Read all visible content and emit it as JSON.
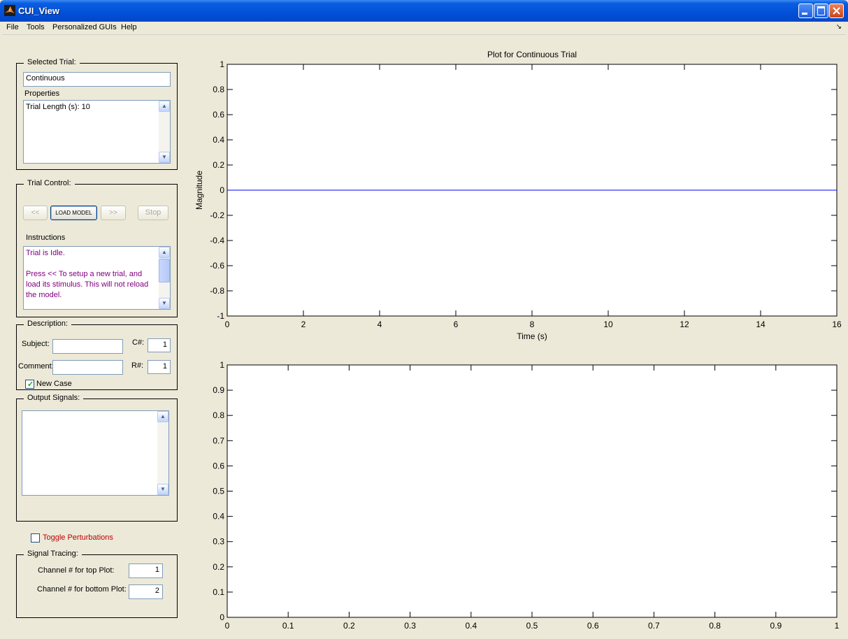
{
  "window": {
    "title": "CUI_View"
  },
  "menu": [
    "File",
    "Tools",
    "Personalized GUIs",
    "Help"
  ],
  "selected_trial": {
    "title": "Selected Trial:",
    "value": "Continuous",
    "properties_label": "Properties",
    "properties": "Trial Length (s): 10"
  },
  "trial_control": {
    "title": "Trial Control:",
    "prev_label": "<<",
    "load_label": "LOAD MODEL",
    "next_label": ">>",
    "stop_label": "Stop",
    "instructions_label": "Instructions",
    "instructions_line1": "Trial is Idle.",
    "instructions_line2": "Press  <<  To setup a new trial, and load its stimulus. This will not reload the model.",
    "instructions_color": "#800080"
  },
  "description": {
    "title": "Description:",
    "subject_label": "Subject:",
    "subject_value": "",
    "comment_label": "Comment:",
    "comment_value": "",
    "c_label": "C#:",
    "c_value": "1",
    "r_label": "R#:",
    "r_value": "1",
    "new_case_label": "New Case",
    "new_case_checked": true
  },
  "output_signals": {
    "title": "Output Signals:"
  },
  "toggle_perturbations": {
    "label": "Toggle Perturbations",
    "checked": false,
    "color": "#c00000"
  },
  "signal_tracing": {
    "title": "Signal Tracing:",
    "top_label": "Channel # for top Plot:",
    "top_value": "1",
    "bottom_label": "Channel # for bottom Plot:",
    "bottom_value": "2"
  },
  "chart_data": [
    {
      "type": "line",
      "title": "Plot for Continuous Trial",
      "xlabel": "Time (s)",
      "ylabel": "Magnitude",
      "xlim": [
        0,
        16
      ],
      "ylim": [
        -1,
        1
      ],
      "xticks": [
        "0",
        "2",
        "4",
        "6",
        "8",
        "10",
        "12",
        "14",
        "16"
      ],
      "yticks": [
        "-1",
        "-0.8",
        "-0.6",
        "-0.4",
        "-0.2",
        "0",
        "0.2",
        "0.4",
        "0.6",
        "0.8",
        "1"
      ],
      "series": [
        {
          "x": [
            0,
            16
          ],
          "y": [
            0,
            0
          ],
          "color": "#0000ff"
        }
      ],
      "grid": false
    },
    {
      "type": "line",
      "title": "",
      "xlabel": "",
      "ylabel": "",
      "xlim": [
        0,
        1
      ],
      "ylim": [
        0,
        1
      ],
      "xticks": [
        "0",
        "0.1",
        "0.2",
        "0.3",
        "0.4",
        "0.5",
        "0.6",
        "0.7",
        "0.8",
        "0.9",
        "1"
      ],
      "yticks": [
        "0",
        "0.1",
        "0.2",
        "0.3",
        "0.4",
        "0.5",
        "0.6",
        "0.7",
        "0.8",
        "0.9",
        "1"
      ],
      "series": [],
      "grid": false
    }
  ]
}
